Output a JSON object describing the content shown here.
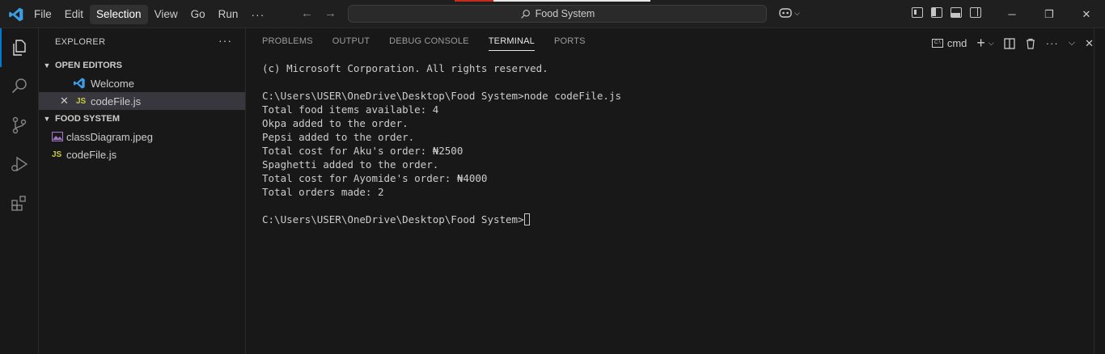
{
  "titlebar": {
    "menu": [
      "File",
      "Edit",
      "Selection",
      "View",
      "Go",
      "Run"
    ],
    "active_menu": "Selection",
    "more": "···",
    "search_text": "Food System"
  },
  "sidebar": {
    "header": "EXPLORER",
    "more": "···",
    "open_editors": {
      "title": "OPEN EDITORS",
      "items": [
        {
          "label": "Welcome",
          "icon": "vscode-icon"
        },
        {
          "label": "codeFile.js",
          "icon": "js-file-icon",
          "badge": "JS",
          "selected": true
        }
      ]
    },
    "folder": {
      "title": "FOOD SYSTEM",
      "items": [
        {
          "label": "classDiagram.jpeg",
          "icon": "image-file-icon"
        },
        {
          "label": "codeFile.js",
          "icon": "js-file-icon",
          "badge": "JS"
        }
      ]
    }
  },
  "panel": {
    "tabs": [
      "PROBLEMS",
      "OUTPUT",
      "DEBUG CONSOLE",
      "TERMINAL",
      "PORTS"
    ],
    "active_tab": "TERMINAL",
    "terminal_name": "cmd",
    "terminal_lines": [
      "(c) Microsoft Corporation. All rights reserved.",
      "",
      "C:\\Users\\USER\\OneDrive\\Desktop\\Food System>node codeFile.js",
      "Total food items available: 4",
      "Okpa added to the order.",
      "Pepsi added to the order.",
      "Total cost for Aku's order: ₦2500",
      "Spaghetti added to the order.",
      "Total cost for Ayomide's order: ₦4000",
      "Total orders made: 2",
      ""
    ],
    "prompt": "C:\\Users\\USER\\OneDrive\\Desktop\\Food System>"
  },
  "colors": {
    "accent": "#0078d4",
    "js_badge": "#cbcb41",
    "background": "#1f1f1f",
    "sidebar_bg": "#181818"
  }
}
